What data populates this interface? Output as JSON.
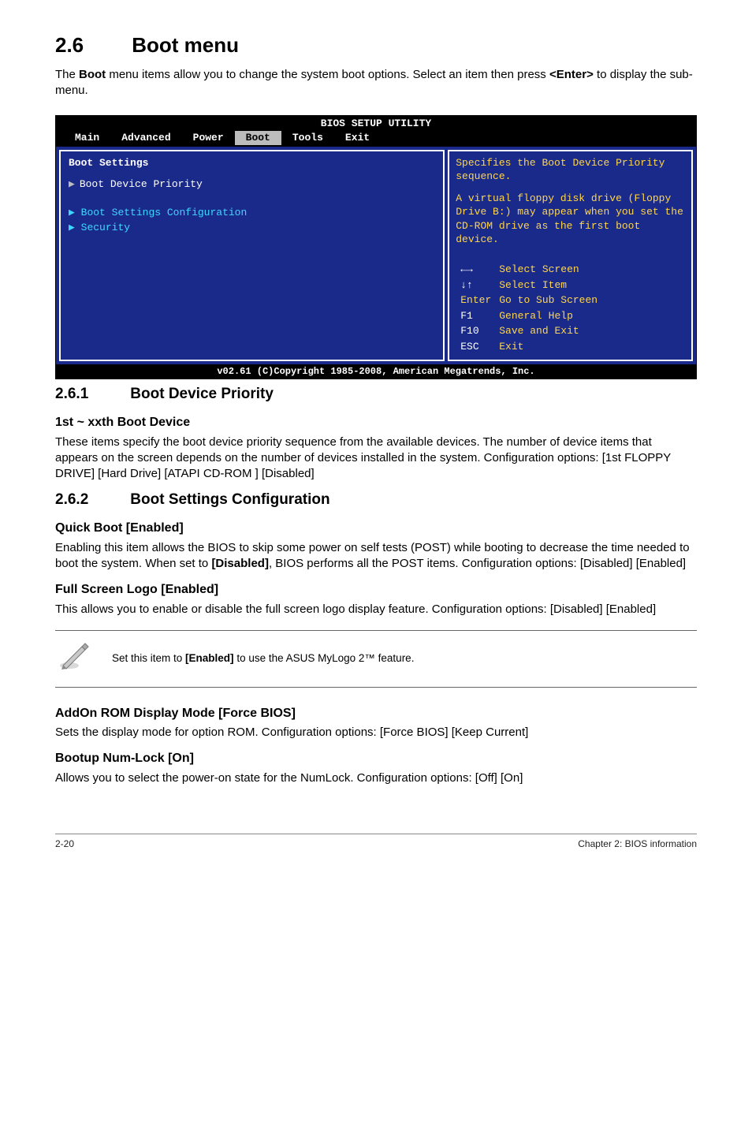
{
  "header": {
    "section_number": "2.6",
    "section_title": "Boot menu",
    "intro_pre": "The ",
    "intro_bold1": "Boot",
    "intro_mid": " menu items allow you to change the system boot options. Select an item then press ",
    "intro_bold2": "<Enter>",
    "intro_post": " to display the sub-menu."
  },
  "bios": {
    "title": "BIOS SETUP UTILITY",
    "menu": {
      "main": "Main",
      "advanced": "Advanced",
      "power": "Power",
      "boot": "Boot",
      "tools": "Tools",
      "exit": "Exit"
    },
    "left": {
      "heading": "Boot Settings",
      "item1": "Boot Device Priority",
      "item2": "Boot Settings Configuration",
      "item3": "Security"
    },
    "right": {
      "help1": "Specifies the Boot Device Priority sequence.",
      "help2": "A virtual floppy disk drive (Floppy Drive B:) may appear when you set the CD-ROM drive as the first boot device.",
      "keys": {
        "arrows_lr_k": "←→",
        "arrows_lr_v": "Select Screen",
        "arrows_ud_k": "↓↑",
        "arrows_ud_v": "Select Item",
        "enter_k": "Enter",
        "enter_v": "Go to Sub Screen",
        "f1_k": "F1",
        "f1_v": "General Help",
        "f10_k": "F10",
        "f10_v": "Save and Exit",
        "esc_k": "ESC",
        "esc_v": "Exit"
      }
    },
    "footer": "v02.61 (C)Copyright 1985-2008, American Megatrends, Inc."
  },
  "s261": {
    "num": "2.6.1",
    "title": "Boot Device Priority",
    "h": "1st ~ xxth Boot Device",
    "p": "These items specify the boot device priority sequence from the available devices. The number of device items that appears on the screen depends on the number of devices installed in the system. Configuration options: [1st FLOPPY DRIVE] [Hard Drive] [ATAPI CD-ROM ] [Disabled]"
  },
  "s262": {
    "num": "2.6.2",
    "title": "Boot Settings Configuration",
    "quick_h": "Quick Boot [Enabled]",
    "quick_p_pre": "Enabling this item allows the BIOS to skip some power on self tests (POST) while booting to decrease the time needed to boot the system. When set to ",
    "quick_p_bold": "[Disabled]",
    "quick_p_post": ", BIOS performs all the POST items. Configuration options: [Disabled] [Enabled]",
    "full_h": "Full Screen Logo [Enabled]",
    "full_p": "This allows you to enable or disable the full screen logo display feature. Configuration options: [Disabled] [Enabled]",
    "note_pre": "Set this item to ",
    "note_bold": "[Enabled]",
    "note_post": " to use the ASUS MyLogo 2™ feature.",
    "addon_h": "AddOn ROM Display Mode [Force BIOS]",
    "addon_p": "Sets the display mode for option ROM. Configuration options: [Force BIOS] [Keep Current]",
    "numlock_h": "Bootup Num-Lock [On]",
    "numlock_p": "Allows you to select the power-on state for the NumLock. Configuration options: [Off] [On]"
  },
  "footer": {
    "left": "2-20",
    "right": "Chapter 2: BIOS information"
  }
}
